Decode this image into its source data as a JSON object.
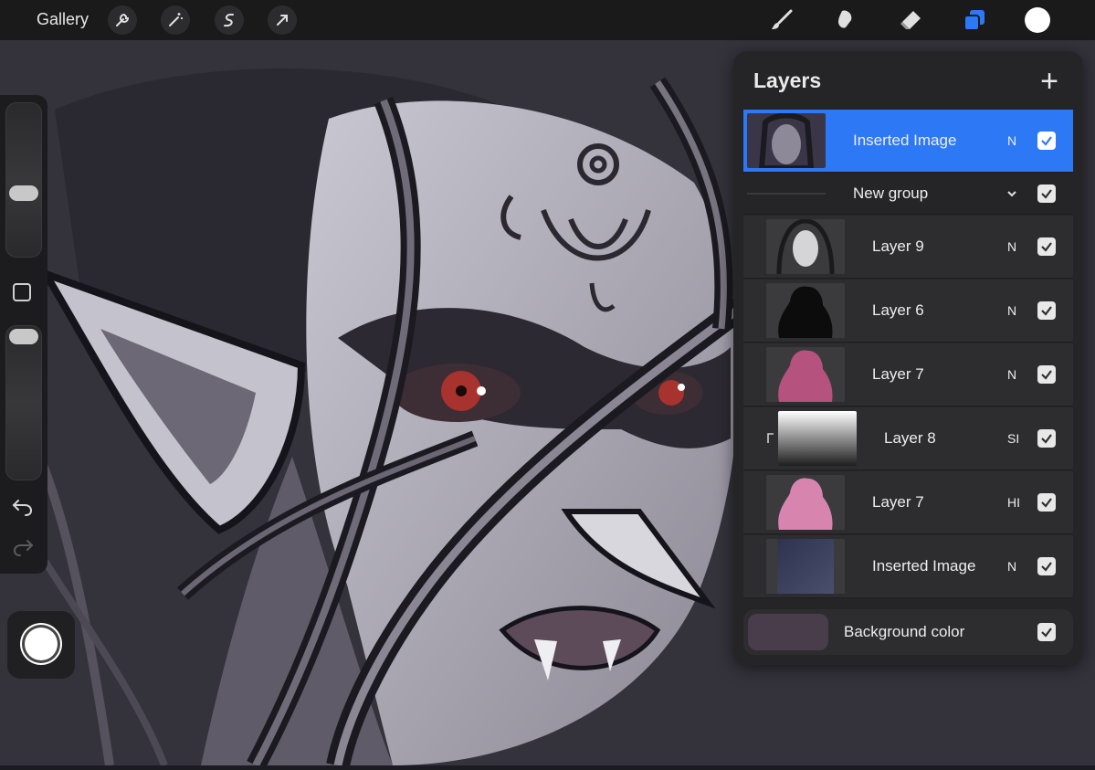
{
  "toolbar": {
    "gallery_label": "Gallery",
    "left_tools": [
      "wrench-icon",
      "magic-wand-icon",
      "selection-icon",
      "transform-arrow-icon"
    ],
    "right_tools": [
      "brush-icon",
      "smudge-icon",
      "eraser-icon",
      "layers-icon"
    ],
    "active_tool": "layers-icon",
    "accent_color": "#2d78f5",
    "current_color": "#ffffff"
  },
  "sidebar": {
    "brush_size_level": 0.55,
    "opacity_level": 1.0
  },
  "layers": {
    "title": "Layers",
    "add_symbol": "+",
    "items": [
      {
        "name": "Inserted Image",
        "blend": "N",
        "visible": true,
        "selected": true,
        "thumb": "art-thumbnail"
      },
      {
        "name": "New group",
        "type": "group",
        "visible": true
      },
      {
        "name": "Layer 9",
        "blend": "N",
        "visible": true,
        "thumb": "art-thumbnail"
      },
      {
        "name": "Layer 6",
        "blend": "N",
        "visible": true,
        "thumb": "silhouette-black"
      },
      {
        "name": "Layer 7",
        "blend": "N",
        "visible": true,
        "thumb": "silhouette-pink"
      },
      {
        "name": "Layer 8",
        "blend": "SI",
        "visible": true,
        "clipped": true,
        "thumb": "gradient-white-black"
      },
      {
        "name": "Layer 7",
        "blend": "HI",
        "visible": true,
        "thumb": "silhouette-light-pink"
      },
      {
        "name": "Inserted Image",
        "blend": "N",
        "visible": true,
        "thumb": "gradient-navy"
      }
    ],
    "background": {
      "name": "Background color",
      "color": "#4a3d4b",
      "visible": true
    }
  }
}
